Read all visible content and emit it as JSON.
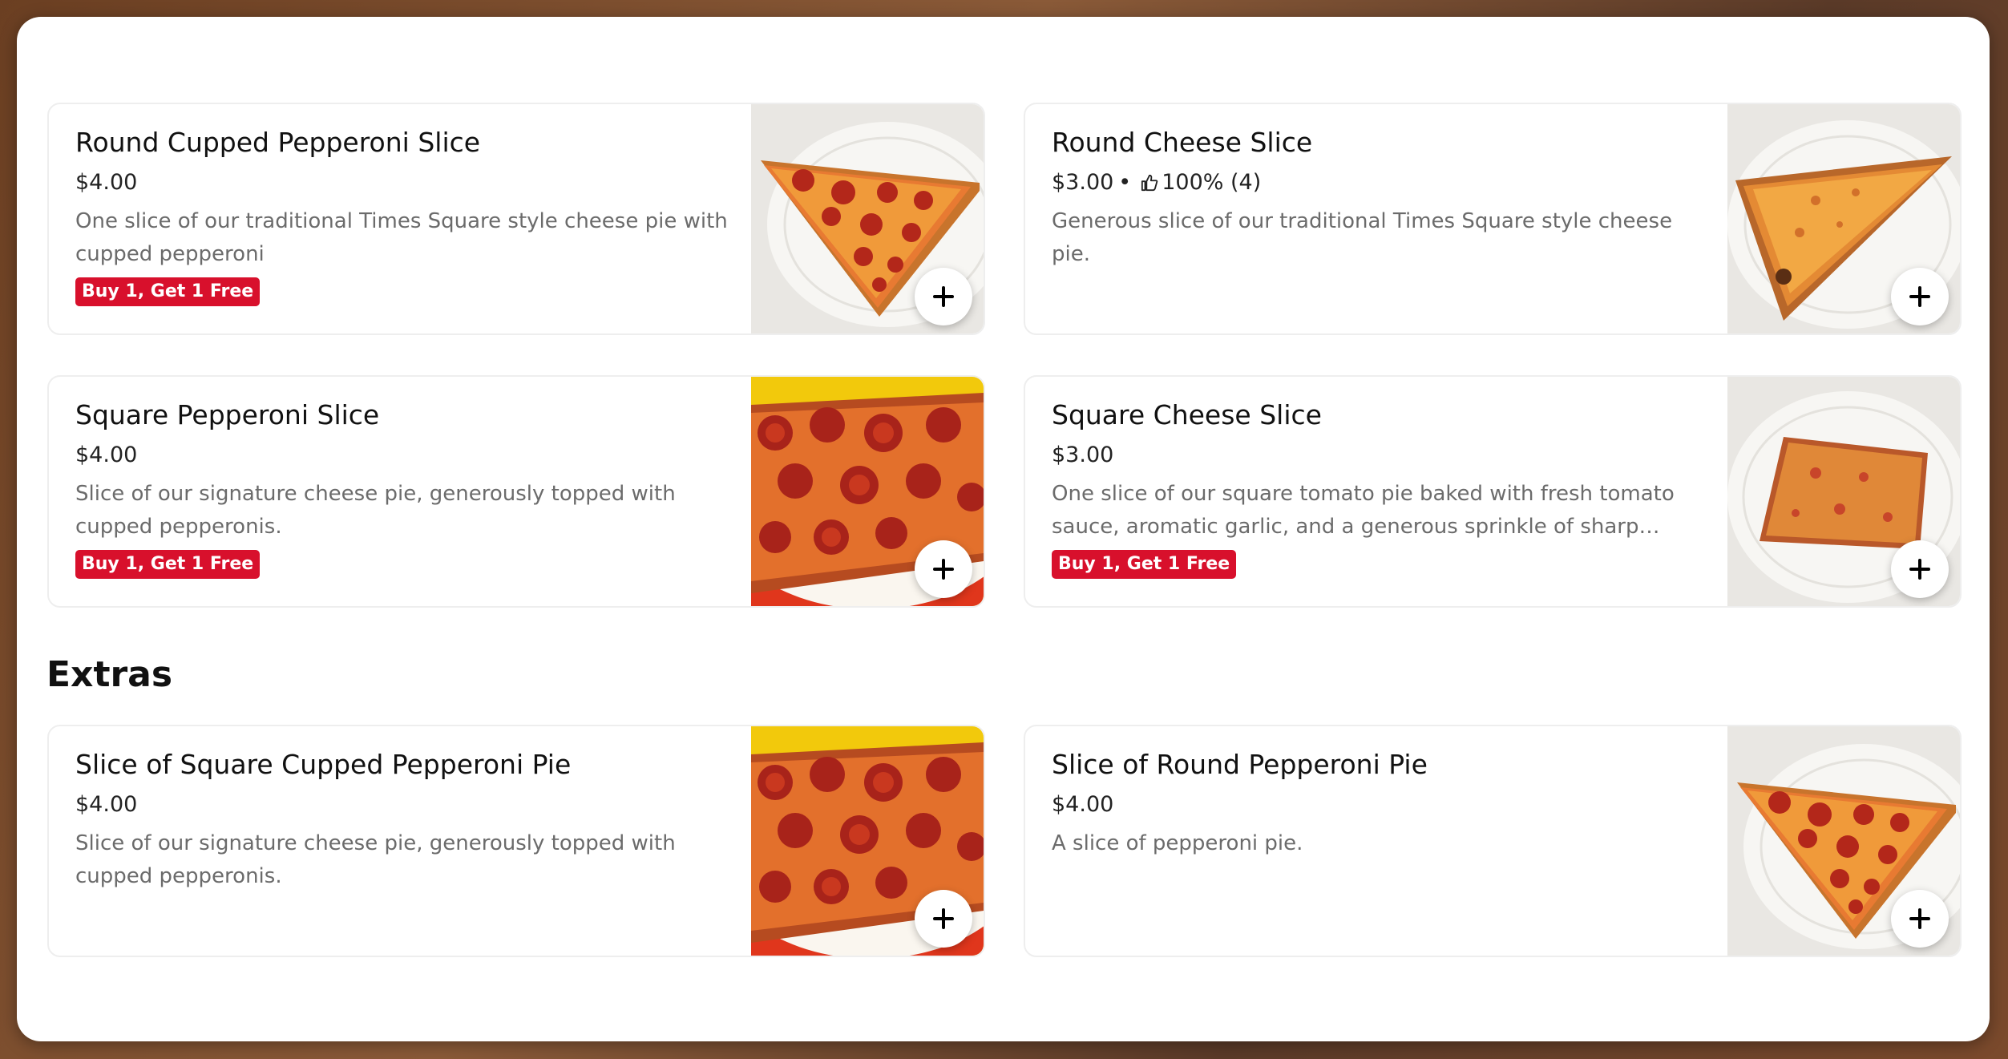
{
  "section": {
    "extras_title": "Extras"
  },
  "items": [
    {
      "title": "Round Cupped Pepperoni Slice",
      "price": "$4.00",
      "description": "One slice of our traditional Times Square style cheese pie with cupped pepperoni",
      "promo": "Buy 1, Get 1 Free",
      "image": "round-pepperoni-slice"
    },
    {
      "title": "Round Cheese Slice",
      "price": "$3.00",
      "rating": "100% (4)",
      "description": "Generous slice of our traditional Times Square style cheese pie.",
      "image": "round-cheese-slice"
    },
    {
      "title": "Square Pepperoni Slice",
      "price": "$4.00",
      "description": "Slice of our signature cheese pie, generously topped with cupped pepperonis.",
      "promo": "Buy 1, Get 1 Free",
      "image": "square-pepperoni-pie"
    },
    {
      "title": "Square Cheese Slice",
      "price": "$3.00",
      "description": "One slice of our square tomato pie baked with fresh tomato sauce, aromatic garlic, and a generous sprinkle of sharp…",
      "promo": "Buy 1, Get 1 Free",
      "image": "square-cheese-slice"
    },
    {
      "title": "Slice of Square Cupped Pepperoni Pie",
      "price": "$4.00",
      "description": "Slice of our signature cheese pie, generously topped with cupped pepperonis.",
      "image": "square-pepperoni-pie"
    },
    {
      "title": "Slice of Round Pepperoni Pie",
      "price": "$4.00",
      "description": "A slice of pepperoni pie.",
      "image": "round-pepperoni-slice"
    }
  ],
  "colors": {
    "promo_bg": "#d8102c",
    "accent_text": "#111111",
    "muted_text": "#6b6b6b",
    "window_bg": "#ffffff"
  },
  "icons": {
    "add": "plus-icon",
    "rating": "thumbs-up-icon"
  }
}
